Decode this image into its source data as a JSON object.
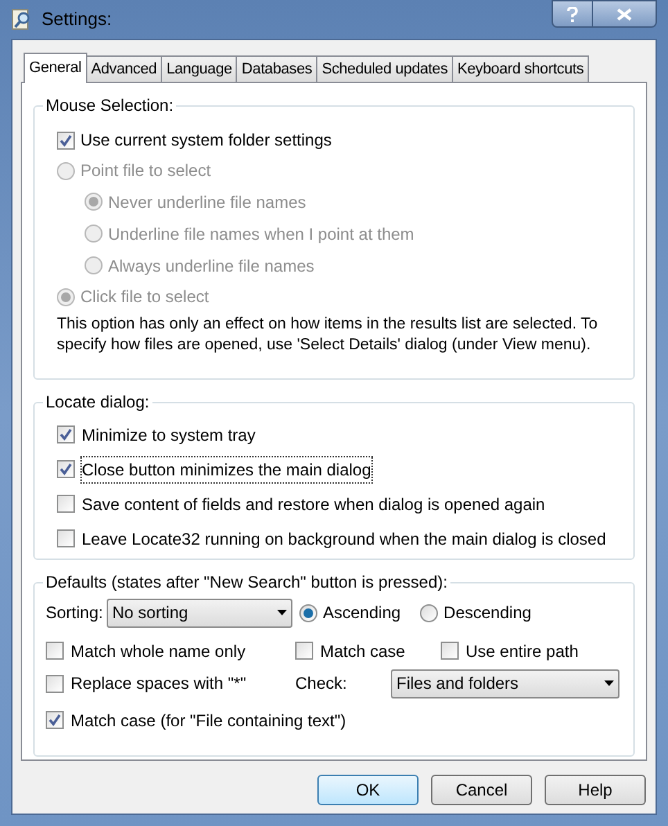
{
  "window": {
    "title": "Settings:"
  },
  "tabs": [
    {
      "label": "General",
      "selected": true
    },
    {
      "label": "Advanced",
      "selected": false
    },
    {
      "label": "Language",
      "selected": false
    },
    {
      "label": "Databases",
      "selected": false
    },
    {
      "label": "Scheduled updates",
      "selected": false
    },
    {
      "label": "Keyboard shortcuts",
      "selected": false
    }
  ],
  "mouse_selection": {
    "title": "Mouse Selection:",
    "items": [
      {
        "kind": "checkbox",
        "label": "Use current system folder settings",
        "checked": true,
        "disabled": false
      },
      {
        "kind": "radio",
        "label": "Point file to select",
        "selected": false,
        "disabled": true,
        "children": [
          {
            "label": "Never underline file names",
            "selected": true,
            "disabled": true
          },
          {
            "label": "Underline file names when I point at them",
            "selected": false,
            "disabled": true
          },
          {
            "label": "Always underline file names",
            "selected": false,
            "disabled": true
          }
        ]
      },
      {
        "kind": "radio",
        "label": "Click file to select",
        "selected": true,
        "disabled": true
      }
    ],
    "note": "This option has only an effect on how items in the results list are selected. To specify how files are opened, use 'Select Details' dialog (under View menu)."
  },
  "locate_dialog": {
    "title": "Locate dialog:",
    "items": [
      {
        "label": "Minimize to system tray",
        "checked": true,
        "focused": false
      },
      {
        "label": "Close button minimizes the main dialog",
        "checked": true,
        "focused": true
      },
      {
        "label": "Save content of fields and restore when dialog is opened again",
        "checked": false,
        "focused": false
      },
      {
        "label": "Leave Locate32 running on background when the main dialog is closed",
        "checked": false,
        "focused": false
      }
    ]
  },
  "defaults": {
    "title": "Defaults (states after \"New Search\" button is pressed):",
    "sorting": {
      "label": "Sorting:",
      "value": "No sorting"
    },
    "order": [
      {
        "label": "Ascending",
        "selected": true
      },
      {
        "label": "Descending",
        "selected": false
      }
    ],
    "match_whole_name": {
      "label": "Match whole name only",
      "checked": false
    },
    "match_case": {
      "label": "Match case",
      "checked": false
    },
    "use_entire_path": {
      "label": "Use entire path",
      "checked": false
    },
    "replace_spaces": {
      "label": "Replace spaces with \"*\"",
      "checked": false
    },
    "check": {
      "label": "Check:",
      "value": "Files and folders"
    },
    "match_case_text": {
      "label": "Match case (for \"File containing text\")",
      "checked": true
    }
  },
  "buttons": [
    {
      "label": "OK",
      "default": true
    },
    {
      "label": "Cancel",
      "default": false
    },
    {
      "label": "Help",
      "default": false
    }
  ]
}
